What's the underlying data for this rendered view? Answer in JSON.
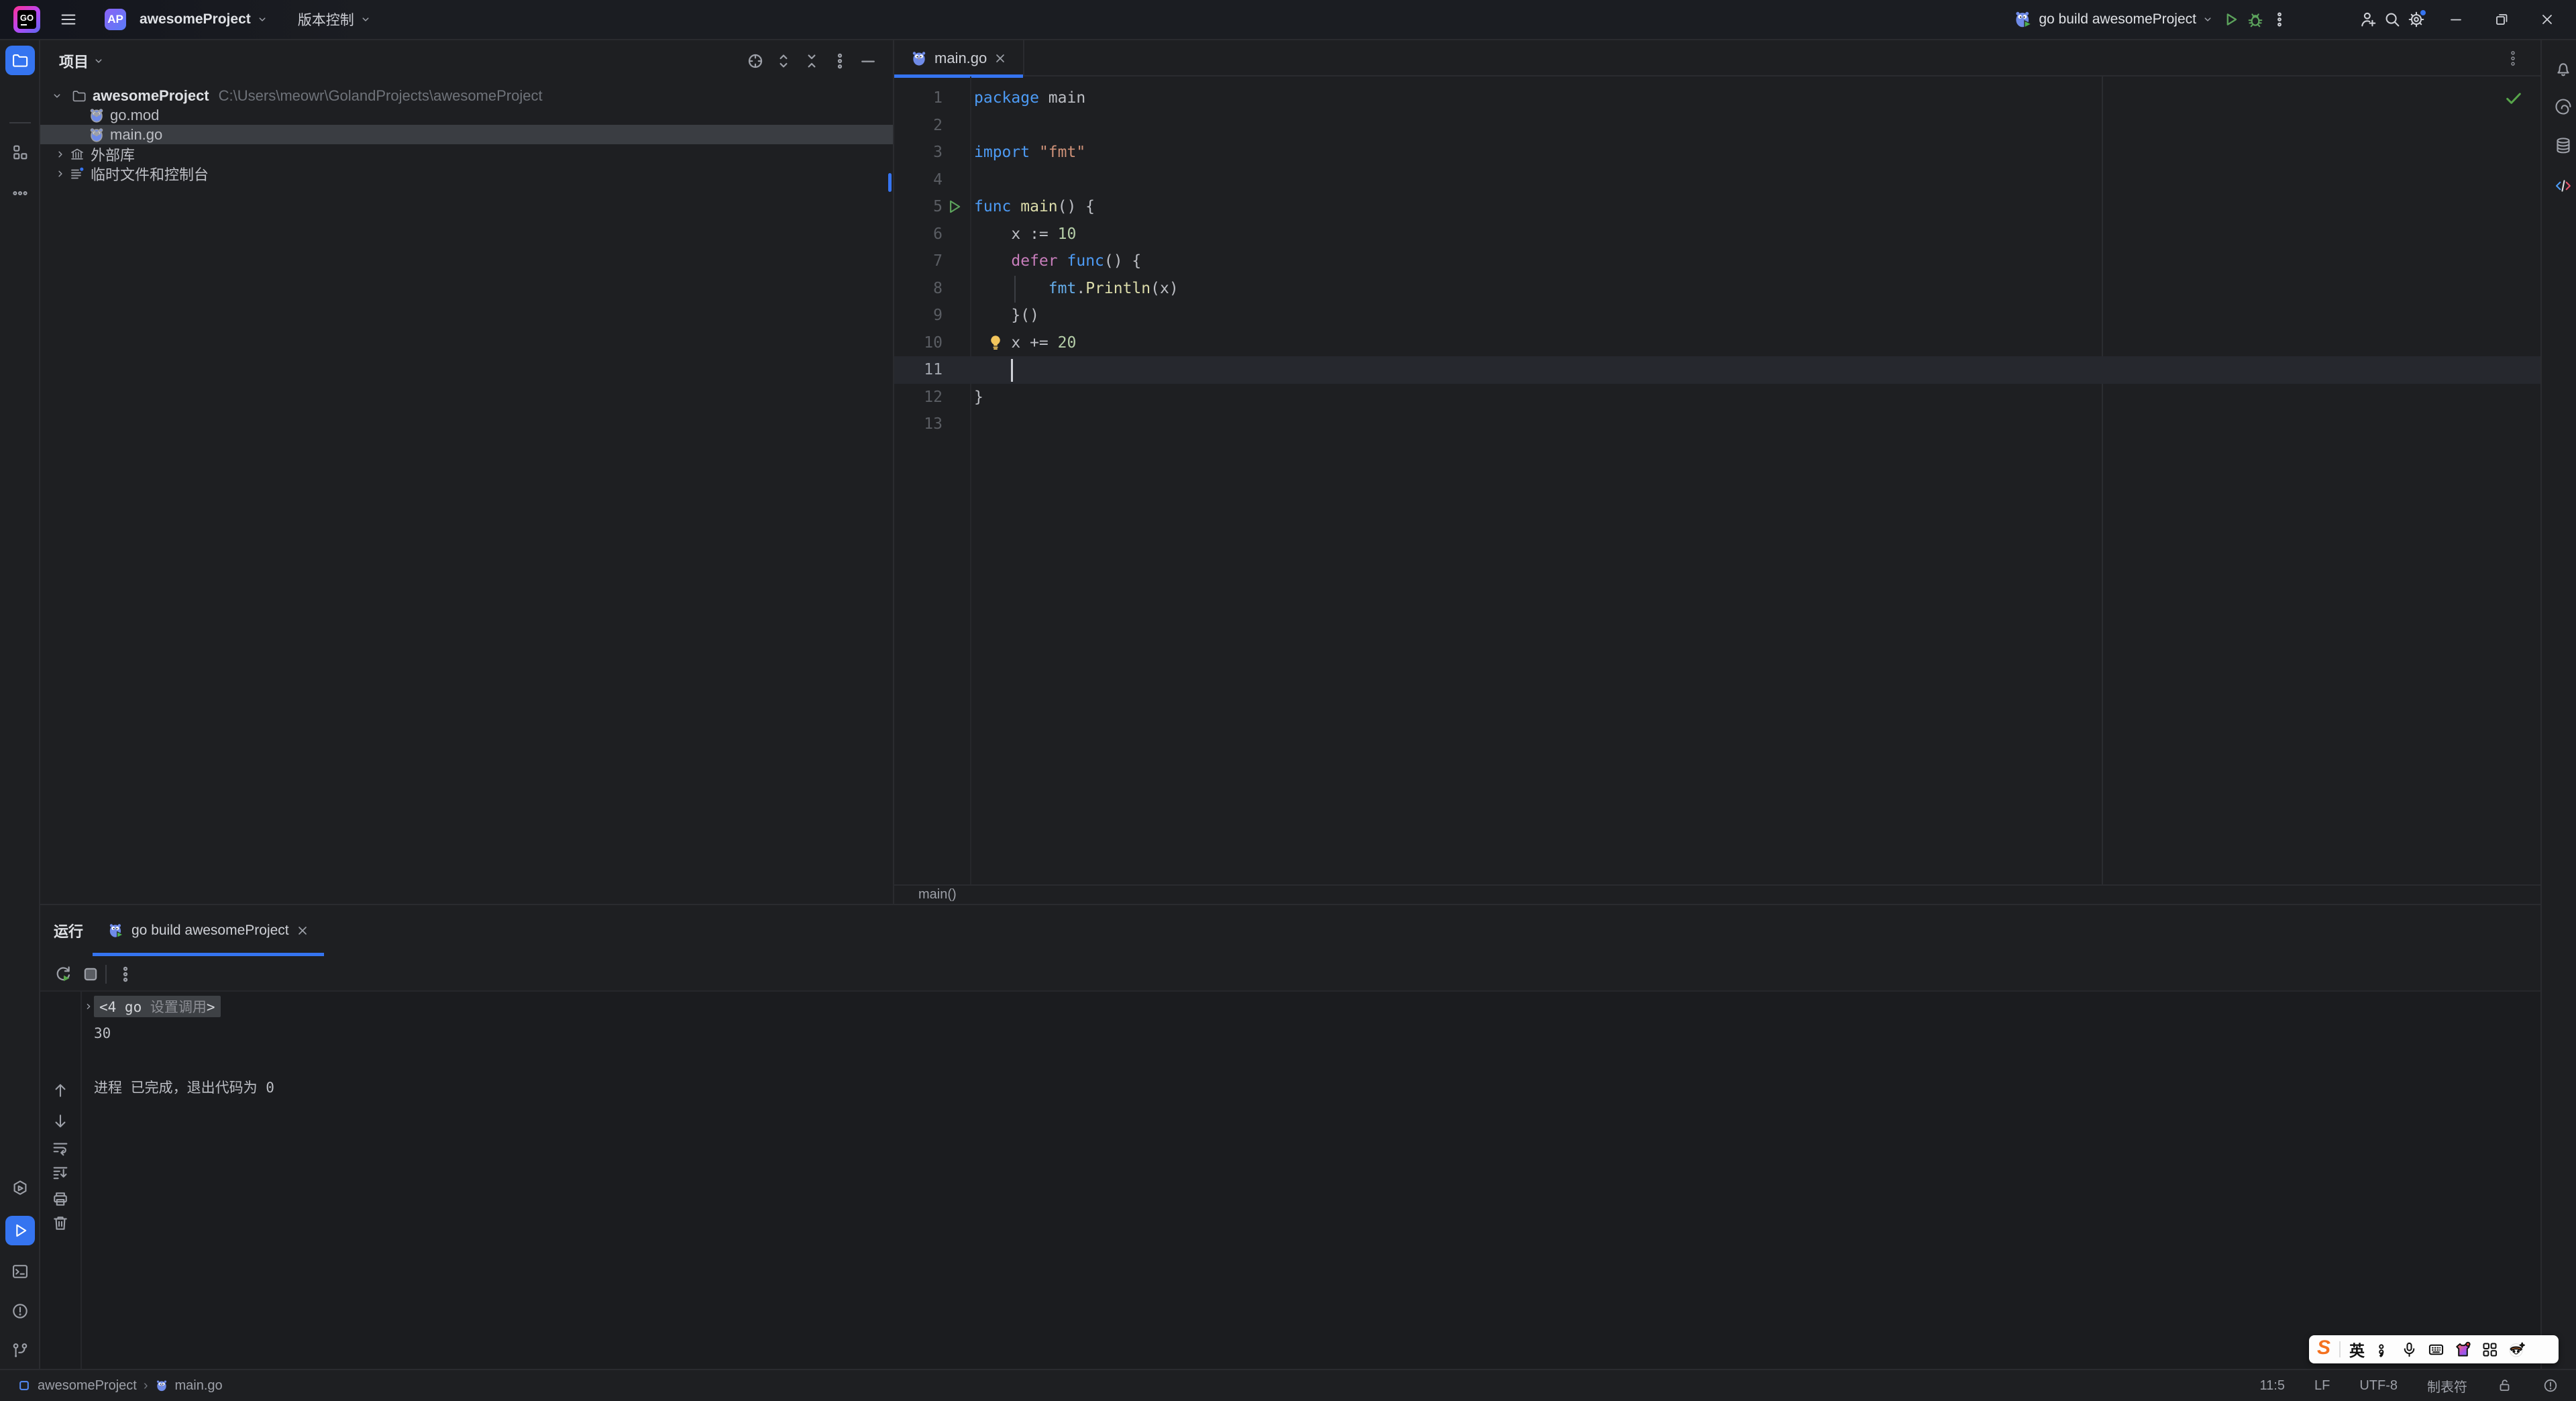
{
  "colors": {
    "accent": "#3574F0",
    "run_green": "#5CA35C",
    "bulb_yellow": "#F2C55C",
    "keyword": "#4D9BF5",
    "control_keyword": "#C77DBB",
    "string": "#CE9178",
    "function_name": "#DCDCAA",
    "number": "#B5CEA8",
    "package_ref": "#66AEEB",
    "editor_bg": "#1E1F22",
    "selection_row": "#3A3D42"
  },
  "titlebar": {
    "logo_text": "GO",
    "avatar_text": "AP",
    "project_name": "awesomeProject",
    "vcs_label": "版本控制",
    "run_config": "go build awesomeProject"
  },
  "left_stripe_top": [
    {
      "id": "project",
      "icon": "folder-icon",
      "active": true
    },
    {
      "id": "structure",
      "icon": "structure-icon",
      "active": false
    },
    {
      "id": "more-toolwindows",
      "icon": "more-horizontal-icon",
      "active": false
    }
  ],
  "left_stripe_bottom": [
    {
      "id": "services",
      "icon": "services-icon",
      "active": false
    },
    {
      "id": "run",
      "icon": "run-play-icon",
      "active": true
    },
    {
      "id": "terminal",
      "icon": "terminal-icon",
      "active": false
    },
    {
      "id": "problems",
      "icon": "problems-icon",
      "active": false
    },
    {
      "id": "version-control",
      "icon": "git-branch-icon",
      "active": false
    }
  ],
  "right_stripe": [
    {
      "id": "notifications",
      "icon": "bell-icon"
    },
    {
      "id": "ai-assistant",
      "icon": "ai-swirl-icon"
    },
    {
      "id": "database",
      "icon": "database-icon"
    },
    {
      "id": "code-tools",
      "icon": "code-tag-icon"
    }
  ],
  "project_panel": {
    "title": "项目",
    "tree": [
      {
        "kind": "root",
        "label": "awesomeProject",
        "path": "C:\\Users\\meowr\\GolandProjects\\awesomeProject",
        "icon": "folder-small-icon",
        "expanded": true
      },
      {
        "kind": "child",
        "label": "go.mod",
        "icon": "gopher-icon"
      },
      {
        "kind": "child",
        "label": "main.go",
        "icon": "gopher-icon",
        "selected": true
      },
      {
        "kind": "node",
        "label": "外部库",
        "icon": "library-icon"
      },
      {
        "kind": "node",
        "label": "临时文件和控制台",
        "icon": "scratch-icon"
      }
    ]
  },
  "editor": {
    "tab_label": "main.go",
    "breadcrumb": "main()",
    "lines": [
      {
        "n": 1,
        "tokens": [
          {
            "t": "package",
            "c": "kw"
          },
          {
            "t": " main",
            "c": "pl"
          }
        ]
      },
      {
        "n": 2,
        "tokens": []
      },
      {
        "n": 3,
        "tokens": [
          {
            "t": "import",
            "c": "kw"
          },
          {
            "t": " ",
            "c": "pl"
          },
          {
            "t": "\"fmt\"",
            "c": "str"
          }
        ]
      },
      {
        "n": 4,
        "tokens": []
      },
      {
        "n": 5,
        "run": true,
        "tokens": [
          {
            "t": "func",
            "c": "kw"
          },
          {
            "t": " ",
            "c": "pl"
          },
          {
            "t": "main",
            "c": "fn"
          },
          {
            "t": "() {",
            "c": "pl"
          }
        ]
      },
      {
        "n": 6,
        "tokens": [
          {
            "t": "    x := ",
            "c": "pl"
          },
          {
            "t": "10",
            "c": "num"
          }
        ]
      },
      {
        "n": 7,
        "tokens": [
          {
            "t": "    ",
            "c": "pl"
          },
          {
            "t": "defer",
            "c": "ctrl"
          },
          {
            "t": " ",
            "c": "pl"
          },
          {
            "t": "func",
            "c": "kw"
          },
          {
            "t": "() {",
            "c": "pl"
          }
        ]
      },
      {
        "n": 8,
        "tokens": [
          {
            "t": "        ",
            "c": "pl"
          },
          {
            "t": "fmt",
            "c": "pkg"
          },
          {
            "t": ".",
            "c": "pl"
          },
          {
            "t": "Println",
            "c": "fn"
          },
          {
            "t": "(x)",
            "c": "pl"
          }
        ]
      },
      {
        "n": 9,
        "tokens": [
          {
            "t": "    }()",
            "c": "pl"
          }
        ]
      },
      {
        "n": 10,
        "bulb": true,
        "tokens": [
          {
            "t": "    x += ",
            "c": "pl"
          },
          {
            "t": "20",
            "c": "num"
          }
        ]
      },
      {
        "n": 11,
        "current": true,
        "cursor": true,
        "cursor_col": 4,
        "tokens": [
          {
            "t": "    ",
            "c": "pl"
          }
        ]
      },
      {
        "n": 12,
        "tokens": [
          {
            "t": "}",
            "c": "pl"
          }
        ]
      },
      {
        "n": 13,
        "tokens": []
      }
    ]
  },
  "bottom_panel": {
    "title": "运行",
    "tab_label": "go build awesomeProject",
    "console": {
      "fold_prefix": "<4 go ",
      "fold_dim": "设置调用",
      "fold_suffix": ">",
      "output": "30",
      "exit_line": "进程 已完成，退出代码为 0"
    }
  },
  "statusbar": {
    "breadcrumb_project": "awesomeProject",
    "breadcrumb_separator": "›",
    "breadcrumb_file": "main.go",
    "caret_position": "11:5",
    "line_separator": "LF",
    "encoding": "UTF-8",
    "indent_style": "制表符"
  },
  "ime": {
    "logo": "S",
    "lang_mode": "英"
  }
}
